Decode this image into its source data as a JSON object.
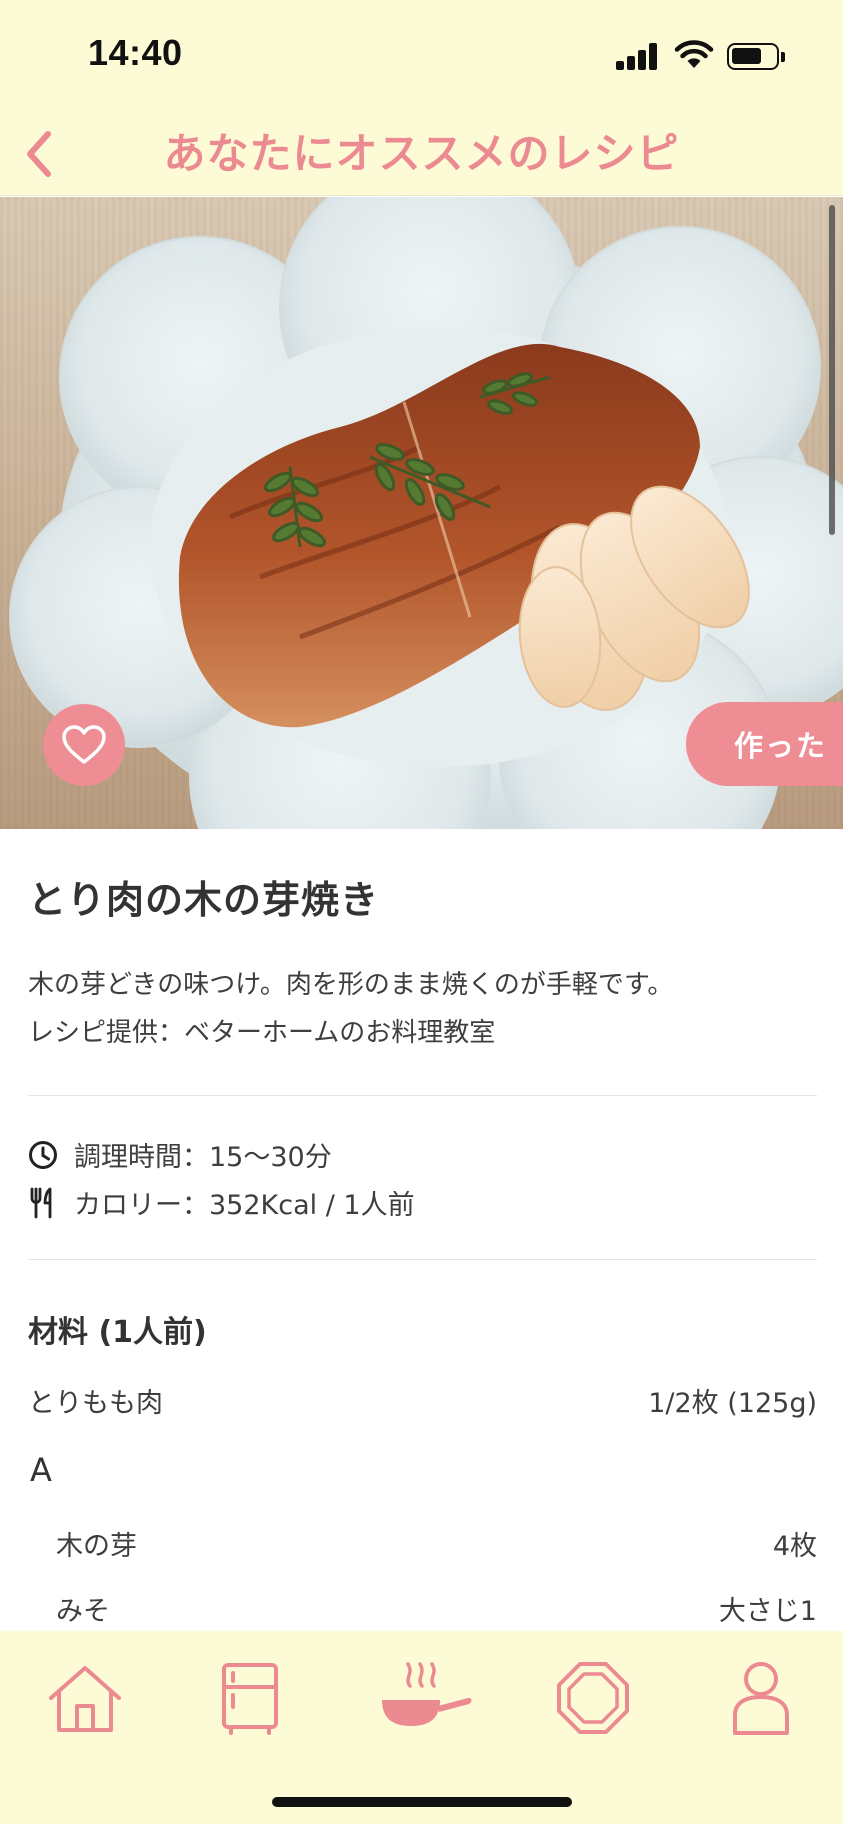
{
  "status_bar": {
    "time": "14:40"
  },
  "nav": {
    "title": "あなたにオススメのレシピ",
    "back_icon": "chevron-left-icon"
  },
  "hero": {
    "favorite_icon": "heart-icon",
    "made_button_label": "作った"
  },
  "recipe": {
    "title": "とり肉の木の芽焼き",
    "description_line1": "木の芽どきの味つけ。肉を形のまま焼くのが手軽です。",
    "description_line2": "レシピ提供：ベターホームのお料理教室",
    "cook_time": "調理時間：15～30分",
    "calories": "カロリー：352Kcal / 1人前",
    "cook_time_icon": "clock-icon",
    "calories_icon": "fork-knife-icon"
  },
  "ingredients": {
    "title": "材料 (1人前)",
    "main": [
      {
        "name": "とりもも肉",
        "amount": "1/2枚 (125g)"
      }
    ],
    "group_a": {
      "label": "A",
      "items": [
        {
          "name": "木の芽",
          "amount": "4枚"
        },
        {
          "name": "みそ",
          "amount": "大さじ1"
        }
      ]
    }
  },
  "tab_bar": {
    "items": [
      {
        "icon": "home-icon"
      },
      {
        "icon": "fridge-icon"
      },
      {
        "icon": "frying-pan-icon"
      },
      {
        "icon": "octagon-icon"
      },
      {
        "icon": "person-icon"
      }
    ]
  },
  "colors": {
    "accent": "#ee8d94",
    "bar_background": "#fdfbd6",
    "text": "#3a3a3a"
  }
}
